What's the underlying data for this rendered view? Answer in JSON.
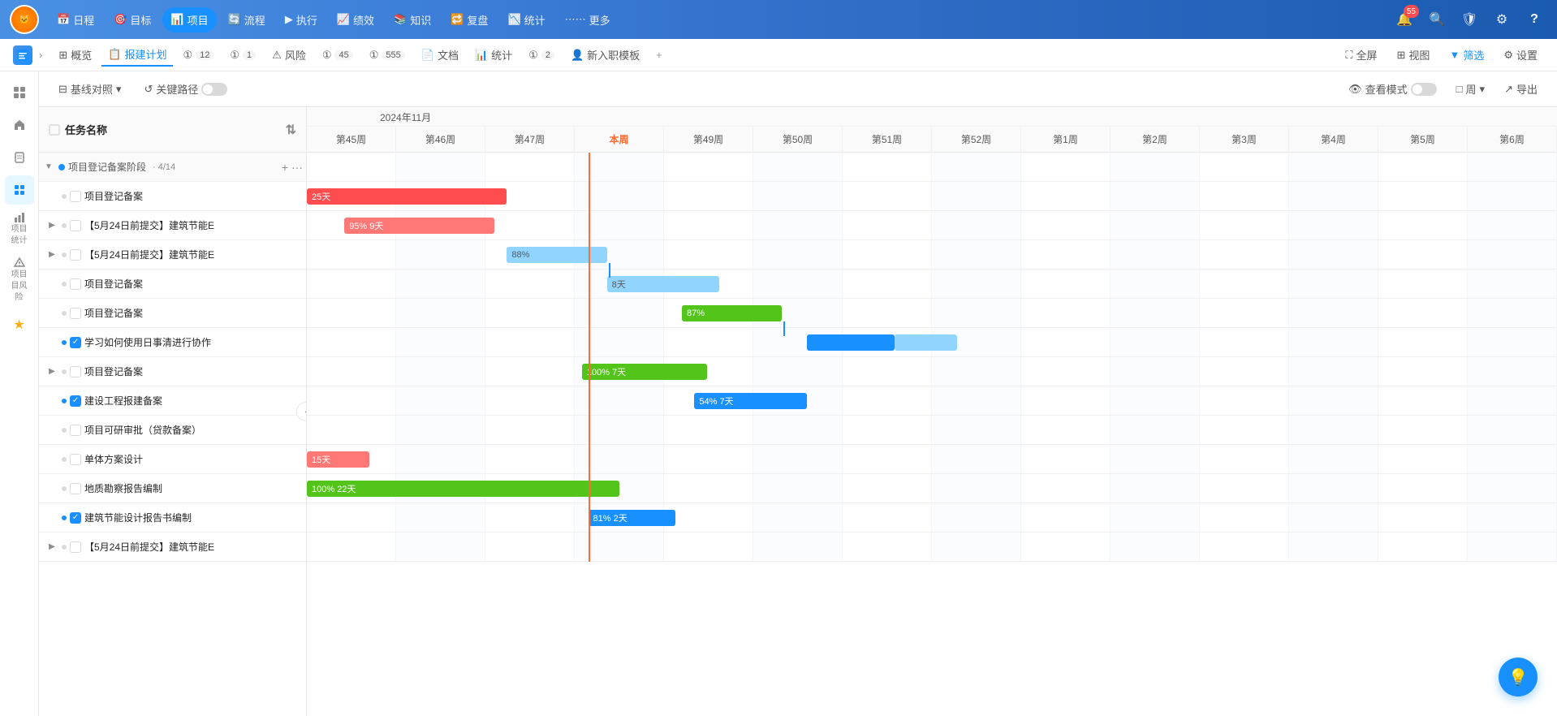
{
  "topNav": {
    "logo": "🐱",
    "items": [
      {
        "id": "schedule",
        "label": "日程",
        "icon": "📅",
        "active": false
      },
      {
        "id": "goal",
        "label": "目标",
        "icon": "🎯",
        "active": false
      },
      {
        "id": "project",
        "label": "项目",
        "icon": "📊",
        "active": true
      },
      {
        "id": "flow",
        "label": "流程",
        "icon": "🔄",
        "active": false
      },
      {
        "id": "exec",
        "label": "执行",
        "icon": "▶",
        "active": false
      },
      {
        "id": "performance",
        "label": "绩效",
        "icon": "📈",
        "active": false
      },
      {
        "id": "knowledge",
        "label": "知识",
        "icon": "📚",
        "active": false
      },
      {
        "id": "review",
        "label": "复盘",
        "icon": "🔁",
        "active": false
      },
      {
        "id": "stats",
        "label": "统计",
        "icon": "📉",
        "active": false
      },
      {
        "id": "more",
        "label": "更多",
        "icon": "⋯",
        "active": false
      }
    ],
    "rightIcons": [
      {
        "id": "notification",
        "icon": "🔔",
        "badge": "55"
      },
      {
        "id": "search",
        "icon": "🔍"
      },
      {
        "id": "shield",
        "icon": "🛡"
      },
      {
        "id": "settings",
        "icon": "⚙"
      },
      {
        "id": "help",
        "icon": "?"
      }
    ]
  },
  "secondNav": {
    "tabs": [
      {
        "id": "overview",
        "label": "概览",
        "icon": "⊞",
        "active": false
      },
      {
        "id": "report-plan",
        "label": "报建计划",
        "icon": "📋",
        "active": true,
        "badge": ""
      },
      {
        "id": "t12",
        "label": "12",
        "icon": "①",
        "active": false
      },
      {
        "id": "t1",
        "label": "1",
        "icon": "①",
        "active": false
      },
      {
        "id": "risk",
        "label": "风险",
        "icon": "⚠",
        "active": false
      },
      {
        "id": "t45",
        "label": "45",
        "icon": "①",
        "active": false
      },
      {
        "id": "t555",
        "label": "555",
        "icon": "①",
        "active": false
      },
      {
        "id": "docs",
        "label": "文档",
        "icon": "📄",
        "active": false
      },
      {
        "id": "statistics",
        "label": "统计",
        "icon": "📊",
        "active": false
      },
      {
        "id": "t2",
        "label": "2",
        "icon": "①",
        "active": false
      },
      {
        "id": "onboard",
        "label": "新入职模板",
        "icon": "👤",
        "active": false
      }
    ],
    "addLabel": "+",
    "rightBtns": [
      {
        "id": "fullscreen",
        "label": "全屏",
        "icon": "⛶"
      },
      {
        "id": "view",
        "label": "视图",
        "icon": "⊞"
      },
      {
        "id": "filter",
        "label": "筛选",
        "icon": "▼"
      },
      {
        "id": "settings2",
        "label": "设置",
        "icon": "⚙"
      }
    ]
  },
  "toolbar": {
    "baselineLabel": "基线对照",
    "criticalPathLabel": "关键路径",
    "viewModeLabel": "查看模式",
    "weekLabel": "周",
    "exportLabel": "导出"
  },
  "taskListHeader": "任务名称",
  "taskGroups": [
    {
      "id": "g1",
      "label": "项目登记备案阶段",
      "count": "4/14",
      "expanded": true,
      "tasks": [
        {
          "id": "t1",
          "name": "项目登记备案",
          "checked": false,
          "hasSub": false,
          "level": 1
        },
        {
          "id": "t2",
          "name": "【5月24日前提交】建筑节能E",
          "checked": false,
          "hasSub": true,
          "level": 1
        },
        {
          "id": "t3",
          "name": "【5月24日前提交】建筑节能E",
          "checked": false,
          "hasSub": true,
          "level": 1
        },
        {
          "id": "t4",
          "name": "项目登记备案",
          "checked": false,
          "hasSub": false,
          "level": 1
        },
        {
          "id": "t5",
          "name": "项目登记备案",
          "checked": false,
          "hasSub": false,
          "level": 1
        },
        {
          "id": "t6",
          "name": "学习如何使用日事清进行协作",
          "checked": true,
          "hasSub": false,
          "level": 1
        },
        {
          "id": "t7",
          "name": "项目登记备案",
          "checked": false,
          "hasSub": true,
          "level": 1
        },
        {
          "id": "t8",
          "name": "建设工程报建备案",
          "checked": true,
          "hasSub": false,
          "level": 1
        },
        {
          "id": "t9",
          "name": "项目可研审批（贷款备案）",
          "checked": false,
          "hasSub": false,
          "level": 1
        },
        {
          "id": "t10",
          "name": "单体方案设计",
          "checked": false,
          "hasSub": false,
          "level": 1
        },
        {
          "id": "t11",
          "name": "地质勘察报告编制",
          "checked": false,
          "hasSub": false,
          "level": 1
        },
        {
          "id": "t12",
          "name": "建筑节能设计报告书编制",
          "checked": true,
          "hasSub": false,
          "level": 1
        },
        {
          "id": "t13",
          "name": "【5月24日前提交】建筑节能E",
          "checked": false,
          "hasSub": true,
          "level": 1
        }
      ]
    }
  ],
  "gantt": {
    "monthLabel": "2024年11月",
    "weeks": [
      {
        "label": "第45周",
        "current": false
      },
      {
        "label": "第46周",
        "current": false
      },
      {
        "label": "第47周",
        "current": false
      },
      {
        "label": "本周",
        "current": true
      },
      {
        "label": "第49周",
        "current": false
      },
      {
        "label": "第50周",
        "current": false
      },
      {
        "label": "第51周",
        "current": false
      },
      {
        "label": "第52周",
        "current": false
      },
      {
        "label": "第1周",
        "current": false
      },
      {
        "label": "第2周",
        "current": false
      },
      {
        "label": "第3周",
        "current": false
      },
      {
        "label": "第4周",
        "current": false
      },
      {
        "label": "第5周",
        "current": false
      },
      {
        "label": "第6周",
        "current": false
      }
    ],
    "bars": [
      {
        "rowIdx": 1,
        "label": "25天",
        "progress": null,
        "type": "red",
        "left": "0%",
        "width": "16%"
      },
      {
        "rowIdx": 2,
        "label": "95%  9天",
        "progress": 95,
        "type": "red-light",
        "left": "3%",
        "width": "12%"
      },
      {
        "rowIdx": 3,
        "label": "88%",
        "progress": 88,
        "type": "blue-light",
        "left": "16%",
        "width": "8%"
      },
      {
        "rowIdx": 4,
        "label": "8天",
        "progress": null,
        "type": "blue-light",
        "left": "24%",
        "width": "9%"
      },
      {
        "rowIdx": 5,
        "label": "87%",
        "progress": 87,
        "type": "green",
        "left": "30%",
        "width": "8%"
      },
      {
        "rowIdx": 6,
        "label": "",
        "progress": null,
        "type": "blue",
        "left": "40%",
        "width": "7%"
      },
      {
        "rowIdx": 7,
        "label": "100%  7天",
        "progress": 100,
        "type": "green",
        "left": "22%",
        "width": "10%"
      },
      {
        "rowIdx": 8,
        "label": "54%  7天",
        "progress": 54,
        "type": "blue",
        "left": "31%",
        "width": "9%"
      },
      {
        "rowIdx": 10,
        "label": "15天",
        "progress": null,
        "type": "red-light",
        "left": "-2%",
        "width": "5%"
      },
      {
        "rowIdx": 11,
        "label": "100%  22天",
        "progress": 100,
        "type": "green",
        "left": "-2%",
        "width": "26%"
      },
      {
        "rowIdx": 12,
        "label": "81%  2天",
        "progress": 81,
        "type": "blue",
        "left": "22.5%",
        "width": "8%"
      }
    ],
    "todayLineLeft": "22.5%"
  },
  "fab": {
    "icon": "💡"
  }
}
